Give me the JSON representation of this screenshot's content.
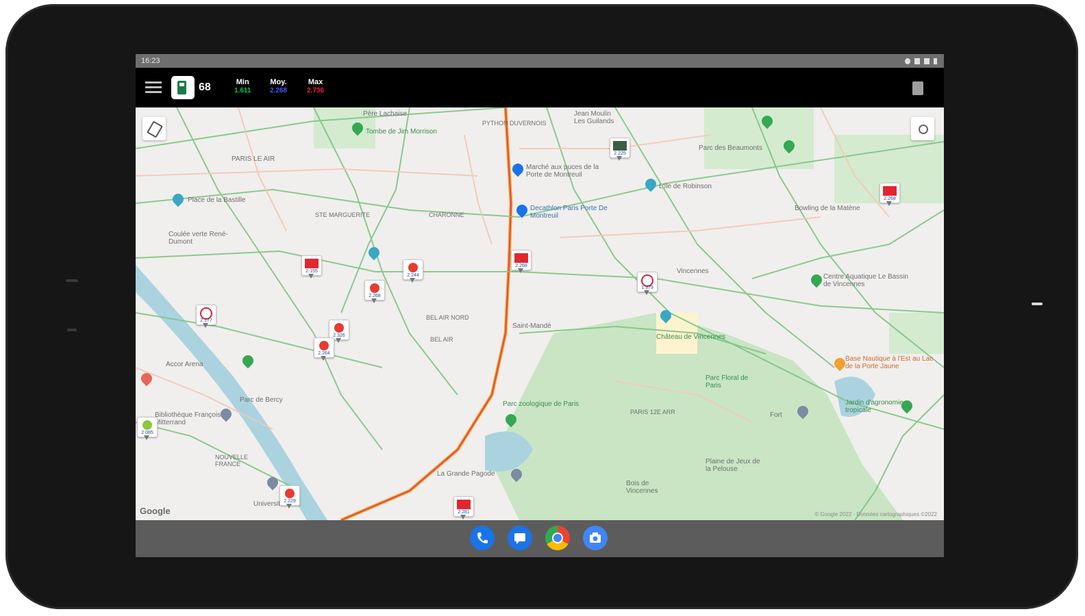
{
  "status_bar": {
    "time": "16:23"
  },
  "app_bar": {
    "department": "68",
    "stats": [
      {
        "label": "Min",
        "value": "1.611",
        "color": "#00c853"
      },
      {
        "label": "Moy.",
        "value": "2.268",
        "color": "#3d5afe"
      },
      {
        "label": "Max",
        "value": "2.736",
        "color": "#ff1744"
      }
    ]
  },
  "map": {
    "labels": {
      "pere_lachaise": "Père Lachaise",
      "tombe_jim_morrison": "Tombe de Jim Morrison",
      "python_duvernois": "PYTHON DUVERNOIS",
      "jean_moulin": "Jean Moulin Les Guilands",
      "paris_le_air": "PARIS LE AIR",
      "place_bastille": "Place de la Bastille",
      "marche_puces": "Marché aux puces de la Porte de Montreuil",
      "lile_robinson": "L'île de Robinson",
      "parc_beaumonts": "Parc des Beaumonts",
      "ste_marguerite": "STE MARGUERITE",
      "charonne": "CHARONNE",
      "decathlon": "Decathlon Paris Porte De Montreuil",
      "bowling": "Bowling de la Matène",
      "coulee_verte": "Coulée verte René-Dumont",
      "centre_aquatique": "Centre Aquatique Le Bassin de Vincennes",
      "vincennes": "Vincennes",
      "bel_air_nord": "BEL AIR NORD",
      "bel_air": "BEL AIR",
      "saint_mande": "Saint-Mandé",
      "chateau_vincennes": "Château de Vincennes",
      "accor_arena": "Accor Arena",
      "parc_bercy": "Parc de Bercy",
      "bnf": "Bibliothèque François-Mitterrand",
      "parc_floral": "Parc Floral de Paris",
      "parc_zoologique": "Parc zoologique de Paris",
      "paris_12e": "PARIS 12E ARR",
      "jardin_agronomie": "Jardin d'agronomie tropicale",
      "bois_vincennes": "Bois de Vincennes",
      "la_grande_pagode": "La Grande Pagode",
      "plaine_jeux": "Plaine de Jeux de la Pelouse",
      "nouvelle_france": "NOUVELLE FRANCE",
      "universite": "Université",
      "base_nautique": "Base Nautique à l'Est au Lac de la Porte Jaune",
      "fort": "Fort"
    },
    "attribution": "Google",
    "copyright": "© Google 2022 · Données cartographiques ©2022",
    "stations": [
      {
        "brand": "avia",
        "price": "2.155"
      },
      {
        "brand": "avia",
        "price": "2.268"
      },
      {
        "brand": "total",
        "price": "2.244"
      },
      {
        "brand": "total",
        "price": "2.268"
      },
      {
        "brand": "esso",
        "price": "1.979"
      },
      {
        "brand": "avia",
        "price": "2.268"
      },
      {
        "brand": "esso",
        "price": "2.177"
      },
      {
        "brand": "total",
        "price": "2.326"
      },
      {
        "brand": "total",
        "price": "2.264"
      },
      {
        "brand": "bp",
        "price": "2.085"
      },
      {
        "brand": "total",
        "price": "2.229"
      },
      {
        "brand": "avia",
        "price": "2.281"
      },
      {
        "brand": "generic",
        "price": "2.225"
      }
    ]
  },
  "dock": {
    "apps": [
      {
        "name": "phone",
        "color": "#1a73e8"
      },
      {
        "name": "messages",
        "color": "#1a73e8"
      },
      {
        "name": "chrome",
        "color": "#34a853"
      },
      {
        "name": "camera",
        "color": "#4285f4"
      }
    ]
  }
}
